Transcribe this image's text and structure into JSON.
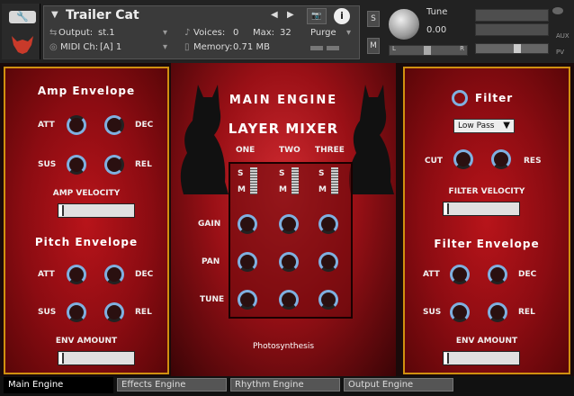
{
  "header": {
    "instrument_name": "Trailer Cat",
    "output_label": "Output:",
    "output_value": "st.1",
    "voices_label": "Voices:",
    "voices_value": "0",
    "max_label": "Max:",
    "max_value": "32",
    "purge_label": "Purge",
    "midi_label": "MIDI Ch:",
    "midi_value": "[A] 1",
    "memory_label": "Memory:",
    "memory_value": "0.71 MB",
    "solo_label": "S",
    "mute_label": "M",
    "tune_label": "Tune",
    "tune_value": "0.00",
    "pan_left": "L",
    "pan_right": "R",
    "aux_label": "AUX",
    "pv_label": "PV"
  },
  "amp_panel": {
    "title": "Amp Envelope",
    "att": "ATT",
    "dec": "DEC",
    "sus": "SUS",
    "rel": "REL",
    "velocity_label": "AMP VELOCITY",
    "pitch_title": "Pitch Envelope",
    "p_att": "ATT",
    "p_dec": "DEC",
    "p_sus": "SUS",
    "p_rel": "REL",
    "env_amount_label": "ENV AMOUNT"
  },
  "center": {
    "engine_title": "Main Engine",
    "mixer_title": "Layer Mixer",
    "layers": [
      "ONE",
      "TWO",
      "THREE"
    ],
    "solo": "S",
    "mute": "M",
    "rows": [
      "GAIN",
      "PAN",
      "TUNE"
    ],
    "preset_name": "Photosynthesis"
  },
  "filter_panel": {
    "title": "Filter",
    "type_value": "Low Pass",
    "cut": "CUT",
    "res": "RES",
    "velocity_label": "FILTER VELOCITY",
    "env_title": "Filter Envelope",
    "att": "ATT",
    "dec": "DEC",
    "sus": "SUS",
    "rel": "REL",
    "env_amount_label": "ENV AMOUNT"
  },
  "tabs": [
    "Main Engine",
    "Effects Engine",
    "Rhythm Engine",
    "Output Engine"
  ],
  "colors": {
    "panel_border": "#d09010",
    "panel_red": "#b8141a",
    "knob_arc": "#7fb0e0"
  }
}
